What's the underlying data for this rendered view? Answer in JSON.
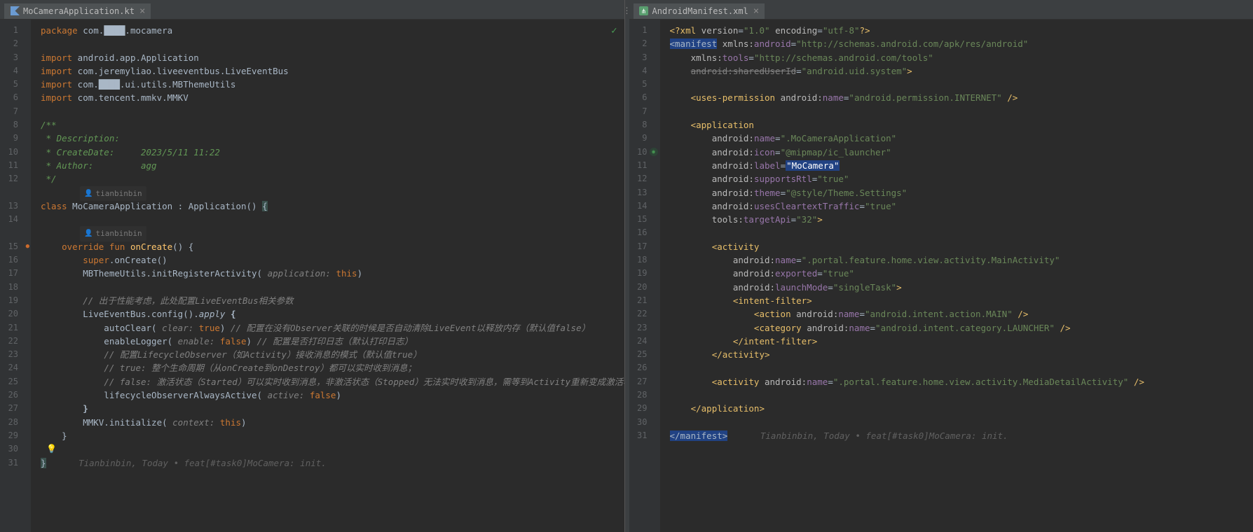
{
  "left": {
    "tab": {
      "filename": "MoCameraApplication.kt",
      "icon": "kotlin-file-icon"
    },
    "author1": "tianbinbin",
    "author2": "tianbinbin",
    "lines": [
      {
        "n": "1",
        "html": "<span class='kw'>package</span> com.████.mocamera"
      },
      {
        "n": "2",
        "html": ""
      },
      {
        "n": "3",
        "html": "<span class='kw'>import</span> android.app.Application"
      },
      {
        "n": "4",
        "html": "<span class='kw'>import</span> com.jeremyliao.liveeventbus.LiveEventBus"
      },
      {
        "n": "5",
        "html": "<span class='kw'>import</span> com.████.ui.utils.MBThemeUtils"
      },
      {
        "n": "6",
        "html": "<span class='kw'>import</span> com.tencent.mmkv.MMKV"
      },
      {
        "n": "7",
        "html": ""
      },
      {
        "n": "8",
        "html": "<span class='comblock'>/**</span>"
      },
      {
        "n": "9",
        "html": "<span class='comblock'> * Description:</span>"
      },
      {
        "n": "10",
        "html": "<span class='comblock'> * CreateDate:     2023/5/11 11:22</span>"
      },
      {
        "n": "11",
        "html": "<span class='comblock'> * Author:         agg</span>"
      },
      {
        "n": "12",
        "html": "<span class='comblock'> */</span>"
      },
      {
        "n": "author1",
        "author": true
      },
      {
        "n": "13",
        "html": "<span class='kw'>class</span> MoCameraApplication : Application() <span class='hl-brace'>{</span>"
      },
      {
        "n": "14",
        "html": ""
      },
      {
        "n": "author2",
        "author": true
      },
      {
        "n": "15",
        "html": "    <span class='kw'>override fun</span> <span class='fn'>onCreate</span>() {",
        "runmark": true
      },
      {
        "n": "16",
        "html": "        <span class='kw'>super</span>.onCreate()"
      },
      {
        "n": "17",
        "html": "        MBThemeUtils.initRegisterActivity( <span class='param'>application:</span> <span class='this'>this</span>)"
      },
      {
        "n": "18",
        "html": ""
      },
      {
        "n": "19",
        "html": "        <span class='com'>// 出于性能考虑，此处配置LiveEventBus相关参数</span>"
      },
      {
        "n": "20",
        "html": "        LiveEventBus.config().<span style='font-style:italic'>apply</span> <span style='font-weight:bold'>{</span>"
      },
      {
        "n": "21",
        "html": "            autoClear( <span class='param'>clear:</span> <span class='bool'>true</span>) <span class='com'>// 配置在没有Observer关联的时候是否自动清除LiveEvent以释放内存（默认值false）</span>"
      },
      {
        "n": "22",
        "html": "            enableLogger( <span class='param'>enable:</span> <span class='bool'>false</span>) <span class='com'>// 配置是否打印日志（默认打印日志）</span>"
      },
      {
        "n": "23",
        "html": "            <span class='com'>// 配置LifecycleObserver（如Activity）接收消息的模式（默认值true）</span>"
      },
      {
        "n": "24",
        "html": "            <span class='com'>// true: 整个生命周期（从onCreate到onDestroy）都可以实时收到消息；</span>"
      },
      {
        "n": "25",
        "html": "            <span class='com'>// false: 激活状态（Started）可以实时收到消息，非激活状态（Stopped）无法实时收到消息，需等到Activity重新变成激活状态，</span>"
      },
      {
        "n": "26",
        "html": "            lifecycleObserverAlwaysActive( <span class='param'>active:</span> <span class='bool'>false</span>)"
      },
      {
        "n": "27",
        "html": "        <span style='font-weight:bold'>}</span>"
      },
      {
        "n": "28",
        "html": "        MMKV.initialize( <span class='param'>context:</span> <span class='this'>this</span>)"
      },
      {
        "n": "29",
        "html": "    }"
      },
      {
        "n": "30",
        "html": "",
        "bulb": true
      },
      {
        "n": "31",
        "html": "<span class='hl-brace'>}</span>   <span class='inline-hint'>Tianbinbin, Today • feat[#task0]MoCamera: init.</span>"
      }
    ]
  },
  "right": {
    "tab": {
      "filename": "AndroidManifest.xml",
      "icon": "xml-file-icon"
    },
    "lines": [
      {
        "n": "1",
        "html": "<span class='tag'>&lt;?xml</span> <span class='attrns'>version</span>=<span class='val'>\"1.0\"</span> <span class='attrns'>encoding</span>=<span class='val'>\"utf-8\"</span><span class='tag'>?&gt;</span>"
      },
      {
        "n": "2",
        "html": "<span class='hl-sel'>&lt;manifest</span> <span class='attrns'>xmlns:</span><span class='attr'>android</span>=<span class='val'>\"http://schemas.android.com/apk/res/android\"</span>"
      },
      {
        "n": "3",
        "html": "    <span class='attrns'>xmlns:</span><span class='attr'>tools</span>=<span class='val'>\"http://schemas.android.com/tools\"</span>"
      },
      {
        "n": "4",
        "html": "    <span class='strike'>android:sharedUserId</span>=<span class='val'>\"android.uid.system\"</span><span class='tag'>&gt;</span>"
      },
      {
        "n": "5",
        "html": ""
      },
      {
        "n": "6",
        "html": "    <span class='tag'>&lt;uses-permission</span> <span class='attrns'>android:</span><span class='attr'>name</span>=<span class='val'>\"android.permission.INTERNET\"</span> <span class='tag'>/&gt;</span>"
      },
      {
        "n": "7",
        "html": ""
      },
      {
        "n": "8",
        "html": "    <span class='tag'>&lt;application</span>"
      },
      {
        "n": "9",
        "html": "        <span class='attrns'>android:</span><span class='attr'>name</span>=<span class='val'>\".MoCameraApplication\"</span>"
      },
      {
        "n": "10",
        "html": "        <span class='attrns'>android:</span><span class='attr'>icon</span>=<span class='val'>\"@mipmap/ic_launcher\"</span>",
        "launchermark": true
      },
      {
        "n": "11",
        "html": "        <span class='attrns'>android:</span><span class='attr'>label</span>=<span class='hl-box'>\"MoCamera\"</span>"
      },
      {
        "n": "12",
        "html": "        <span class='attrns'>android:</span><span class='attr'>supportsRtl</span>=<span class='val'>\"true\"</span>"
      },
      {
        "n": "13",
        "html": "        <span class='attrns'>android:</span><span class='attr'>theme</span>=<span class='val'>\"@style/Theme.Settings\"</span>"
      },
      {
        "n": "14",
        "html": "        <span class='attrns'>android:</span><span class='attr'>usesCleartextTraffic</span>=<span class='val'>\"true\"</span>"
      },
      {
        "n": "15",
        "html": "        <span class='attrns'>tools:</span><span class='attr'>targetApi</span>=<span class='val'>\"32\"</span><span class='tag'>&gt;</span>"
      },
      {
        "n": "16",
        "html": ""
      },
      {
        "n": "17",
        "html": "        <span class='tag'>&lt;activity</span>"
      },
      {
        "n": "18",
        "html": "            <span class='attrns'>android:</span><span class='attr'>name</span>=<span class='val'>\".portal.feature.home.view.activity.MainActivity\"</span>"
      },
      {
        "n": "19",
        "html": "            <span class='attrns'>android:</span><span class='attr'>exported</span>=<span class='val'>\"true\"</span>"
      },
      {
        "n": "20",
        "html": "            <span class='attrns'>android:</span><span class='attr'>launchMode</span>=<span class='val'>\"singleTask\"</span><span class='tag'>&gt;</span>"
      },
      {
        "n": "21",
        "html": "            <span class='tag'>&lt;intent-filter&gt;</span>"
      },
      {
        "n": "22",
        "html": "                <span class='tag'>&lt;action</span> <span class='attrns'>android:</span><span class='attr'>name</span>=<span class='val'>\"android.intent.action.MAIN\"</span> <span class='tag'>/&gt;</span>"
      },
      {
        "n": "23",
        "html": "                <span class='tag'>&lt;category</span> <span class='attrns'>android:</span><span class='attr'>name</span>=<span class='val'>\"android.intent.category.LAUNCHER\"</span> <span class='tag'>/&gt;</span>"
      },
      {
        "n": "24",
        "html": "            <span class='tag'>&lt;/intent-filter&gt;</span>"
      },
      {
        "n": "25",
        "html": "        <span class='tag'>&lt;/activity&gt;</span>"
      },
      {
        "n": "26",
        "html": ""
      },
      {
        "n": "27",
        "html": "        <span class='tag'>&lt;activity</span> <span class='attrns'>android:</span><span class='attr'>name</span>=<span class='val'>\".portal.feature.home.view.activity.MediaDetailActivity\"</span> <span class='tag'>/&gt;</span>"
      },
      {
        "n": "28",
        "html": ""
      },
      {
        "n": "29",
        "html": "    <span class='tag'>&lt;/application&gt;</span>"
      },
      {
        "n": "30",
        "html": ""
      },
      {
        "n": "31",
        "html": "<span class='hl-sel'>&lt;/manifest&gt;</span>   <span class='inline-hint'>Tianbinbin, Today • feat[#task0]MoCamera: init.</span>"
      }
    ]
  }
}
